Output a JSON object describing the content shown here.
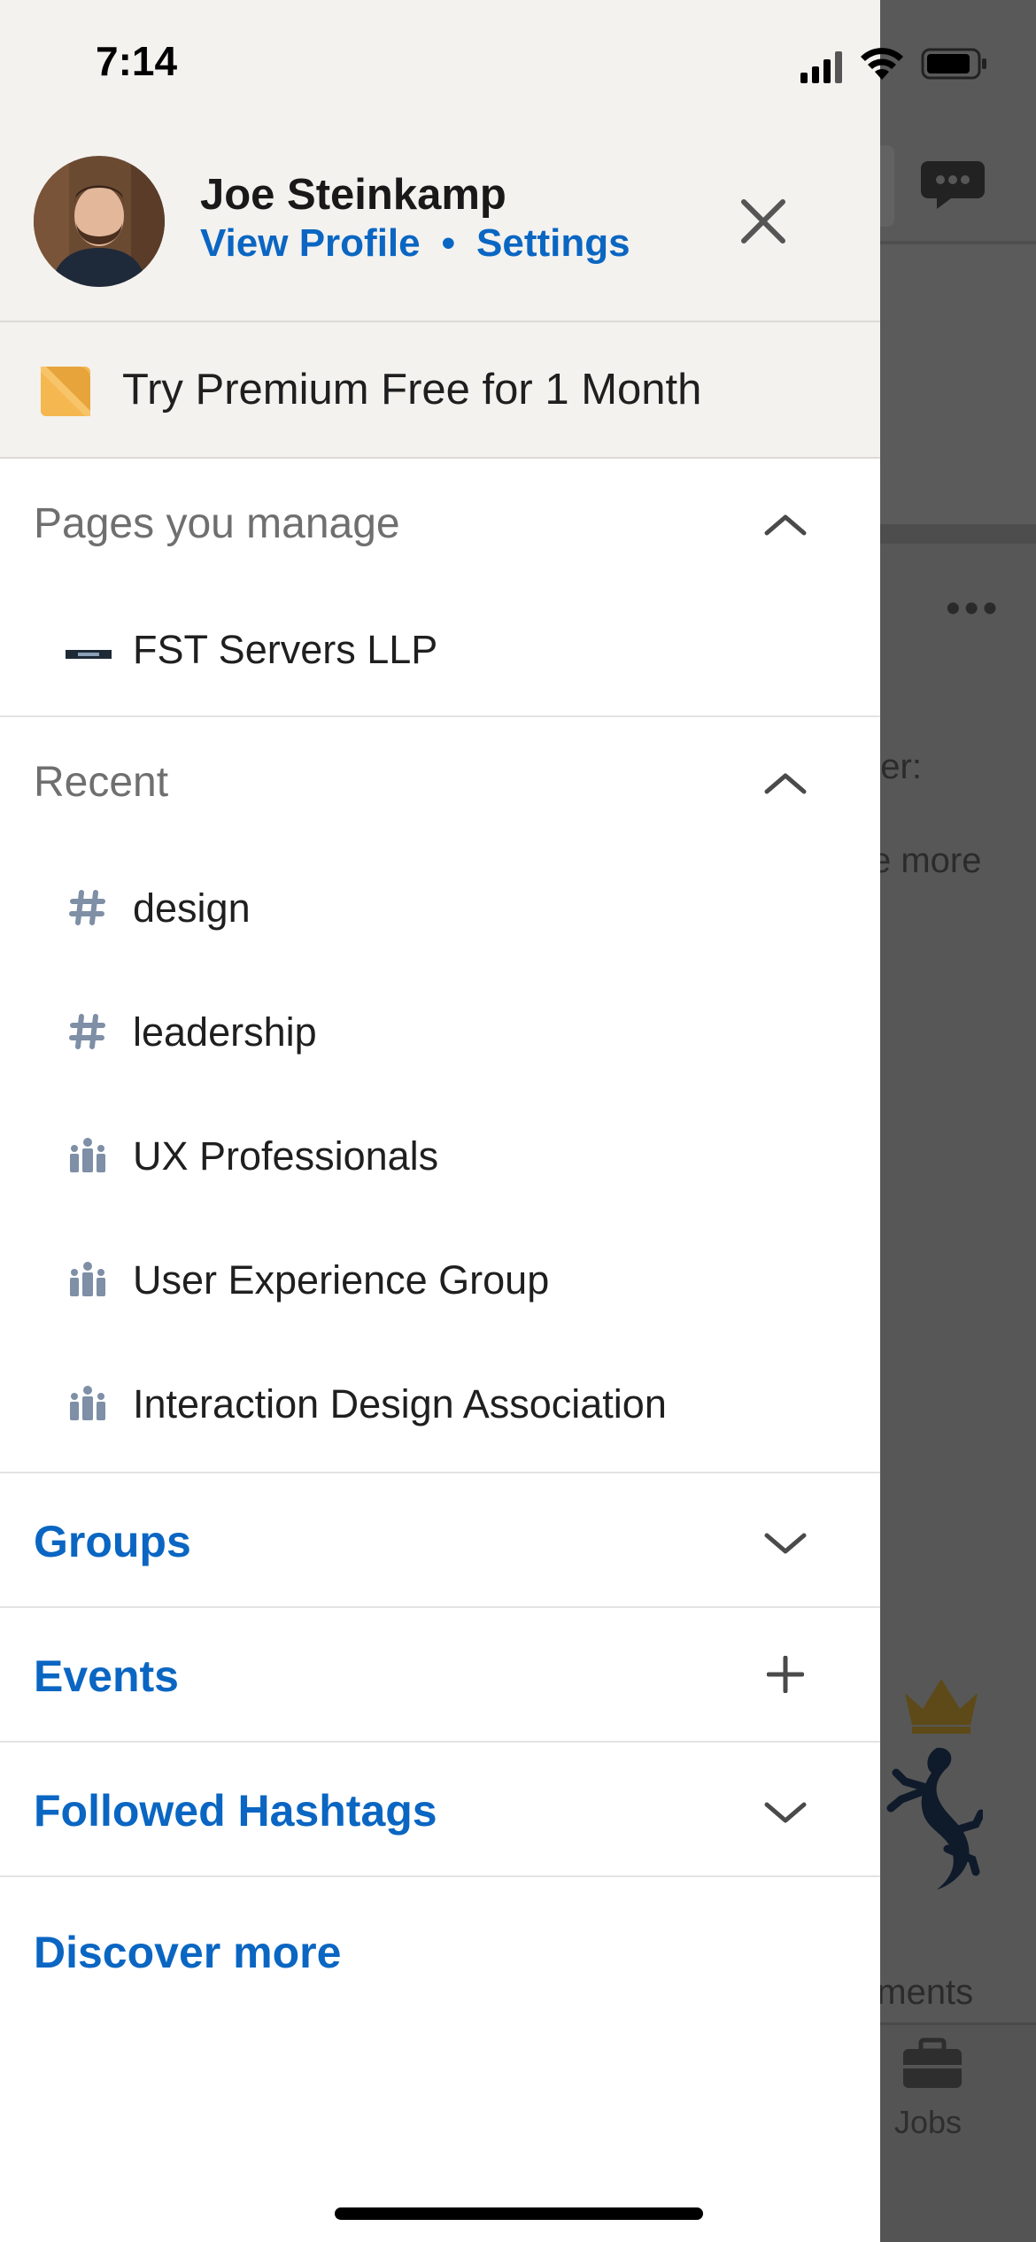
{
  "status_bar": {
    "time": "7:14"
  },
  "background": {
    "more_label": "•••",
    "snippet_1": "ner:",
    "snippet_2": "e more",
    "snippet_3": "nments",
    "tab_jobs": "Jobs"
  },
  "profile": {
    "name": "Joe Steinkamp",
    "view_profile": "View Profile",
    "separator": "•",
    "settings": "Settings"
  },
  "premium": {
    "label": "Try Premium Free for 1 Month",
    "accent_color": "#f5b74f"
  },
  "pages_section": {
    "title": "Pages you manage",
    "items": [
      {
        "label": "FST Servers LLP",
        "icon": "company-logo-icon"
      }
    ]
  },
  "recent_section": {
    "title": "Recent",
    "items": [
      {
        "label": "design",
        "icon": "hashtag-icon"
      },
      {
        "label": "leadership",
        "icon": "hashtag-icon"
      },
      {
        "label": "UX Professionals",
        "icon": "group-icon"
      },
      {
        "label": "User Experience Group",
        "icon": "group-icon"
      },
      {
        "label": "Interaction Design Association",
        "icon": "group-icon"
      }
    ]
  },
  "nav": {
    "groups": "Groups",
    "events": "Events",
    "followed_hashtags": "Followed Hashtags",
    "discover_more": "Discover more"
  },
  "colors": {
    "link_blue": "#0a66c2",
    "panel_bg": "#f3f2ef",
    "icon_gray": "#7e8fa6"
  }
}
